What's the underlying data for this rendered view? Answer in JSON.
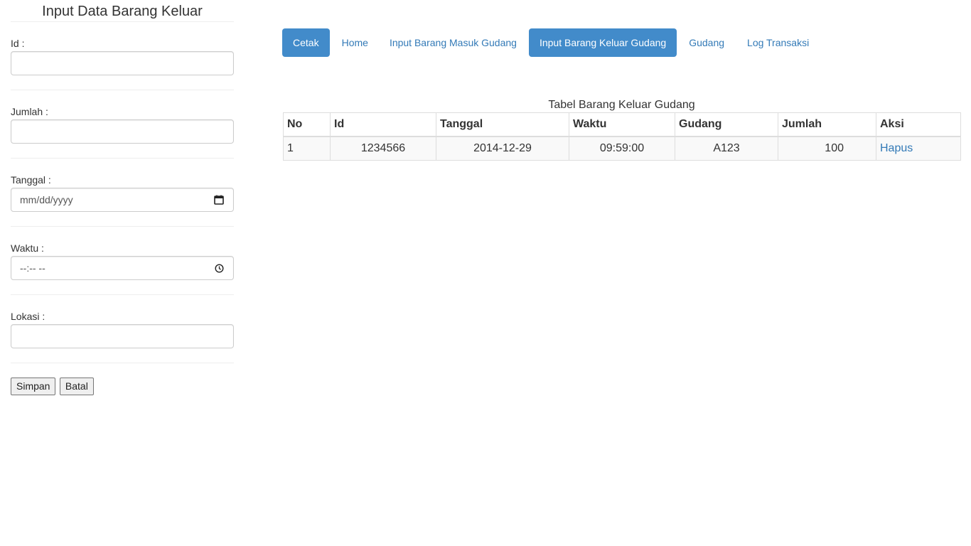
{
  "form": {
    "title": "Input Data Barang Keluar",
    "fields": {
      "id": {
        "label": "Id :",
        "value": ""
      },
      "jumlah": {
        "label": "Jumlah :",
        "value": ""
      },
      "tanggal": {
        "label": "Tanggal :",
        "placeholder": "mm/dd/yyyy"
      },
      "waktu": {
        "label": "Waktu :",
        "placeholder": "--:-- --"
      },
      "lokasi": {
        "label": "Lokasi :",
        "value": ""
      }
    },
    "buttons": {
      "save": "Simpan",
      "cancel": "Batal"
    }
  },
  "nav": {
    "items": [
      {
        "label": "Cetak",
        "active": true
      },
      {
        "label": "Home",
        "active": false
      },
      {
        "label": "Input Barang Masuk Gudang",
        "active": false
      },
      {
        "label": "Input Barang Keluar Gudang",
        "active": true
      },
      {
        "label": "Gudang",
        "active": false
      },
      {
        "label": "Log Transaksi",
        "active": false
      }
    ]
  },
  "table": {
    "caption": "Tabel Barang Keluar Gudang",
    "headers": [
      "No",
      "Id",
      "Tanggal",
      "Waktu",
      "Gudang",
      "Jumlah",
      "Aksi"
    ],
    "rows": [
      {
        "no": "1",
        "id": "1234566",
        "tanggal": "2014-12-29",
        "waktu": "09:59:00",
        "gudang": "A123",
        "jumlah": "100",
        "aksi": "Hapus"
      }
    ]
  },
  "colors": {
    "accent": "#428bca",
    "link": "#337ab7"
  },
  "icons": {
    "date": "calendar-icon",
    "time": "clock-icon"
  }
}
